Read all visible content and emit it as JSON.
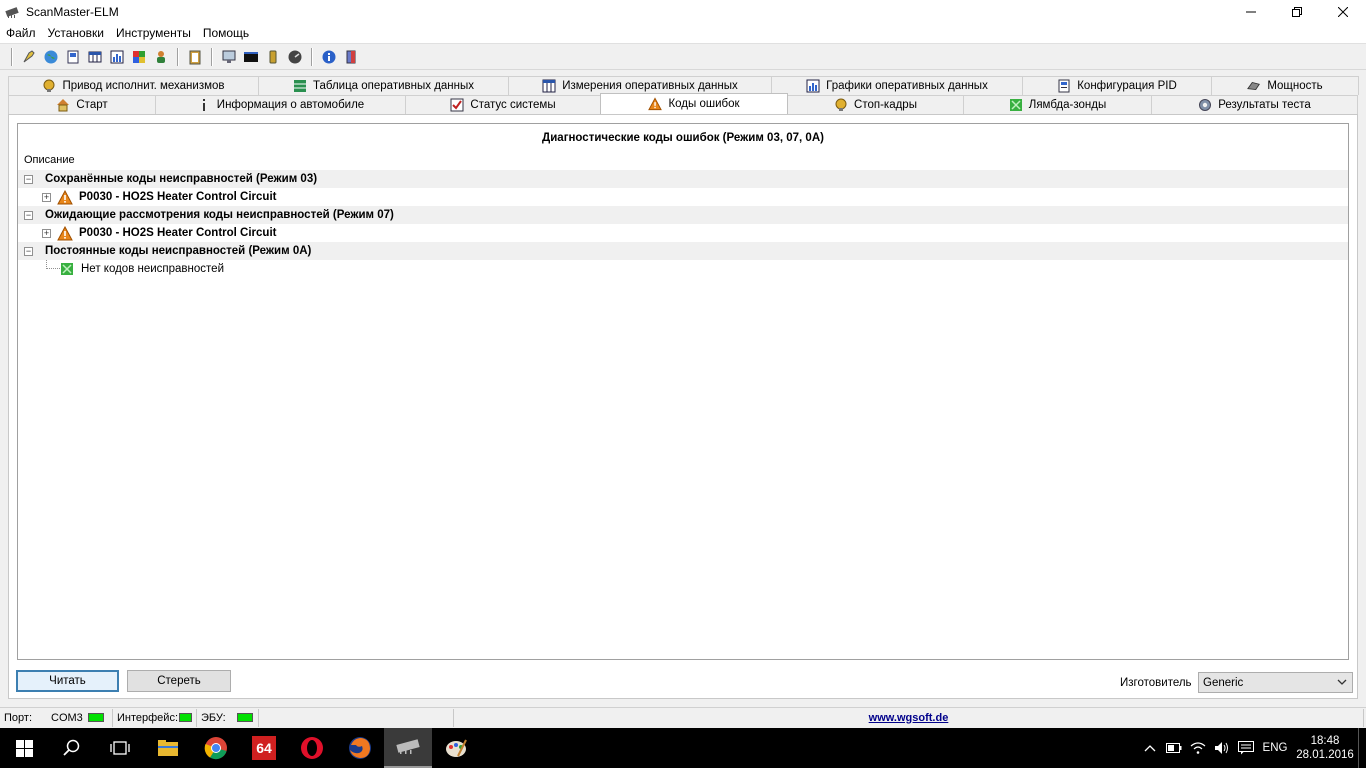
{
  "window": {
    "title": "ScanMaster-ELM"
  },
  "menu": [
    "Файл",
    "Установки",
    "Инструменты",
    "Помощь"
  ],
  "tabs": {
    "row_top": [
      {
        "label": "Привод исполнит. механизмов",
        "icon": "actuator-icon"
      },
      {
        "label": "Таблица оперативных данных",
        "icon": "table-icon"
      },
      {
        "label": "Измерения оперативных данных",
        "icon": "grid-icon"
      },
      {
        "label": "Графики оперативных данных",
        "icon": "chart-icon"
      },
      {
        "label": "Конфигурация PID",
        "icon": "config-icon"
      },
      {
        "label": "Мощность",
        "icon": "power-icon"
      }
    ],
    "row_bottom": [
      {
        "label": "Старт",
        "icon": "home-icon"
      },
      {
        "label": "Информация о автомобиле",
        "icon": "info-icon"
      },
      {
        "label": "Статус системы",
        "icon": "checklist-icon"
      },
      {
        "label": "Коды ошибок",
        "icon": "warning-icon",
        "active": true
      },
      {
        "label": "Стоп-кадры",
        "icon": "freeze-icon"
      },
      {
        "label": "Лямбда-зонды",
        "icon": "sensor-icon"
      },
      {
        "label": "Результаты теста",
        "icon": "gear-icon"
      }
    ]
  },
  "content": {
    "heading": "Диагностические коды ошибок (Режим 03, 07, 0A)",
    "column_header": "Описание",
    "groups": [
      {
        "label": "Сохранённые коды неисправностей (Режим 03)",
        "items": [
          {
            "label": "P0030 - HO2S Heater Control Circuit"
          }
        ]
      },
      {
        "label": "Ожидающие рассмотрения коды неисправностей (Режим 07)",
        "items": [
          {
            "label": "P0030 - HO2S Heater Control Circuit"
          }
        ]
      },
      {
        "label": "Постоянные коды неисправностей  (Режим 0A)",
        "leaf": "Нет кодов неисправностей"
      }
    ]
  },
  "buttons": {
    "read": "Читать",
    "erase": "Стереть"
  },
  "manufacturer": {
    "label": "Изготовитель",
    "value": "Generic"
  },
  "status": {
    "port_label": "Порт:",
    "port_value": "COM3",
    "interface_label": "Интерфейс:",
    "ecu_label": "ЭБУ:",
    "link": "www.wgsoft.de"
  },
  "taskbar": {
    "lang": "ENG",
    "time": "18:48",
    "date": "28.01.2016",
    "badge": "64"
  },
  "colors": {
    "led": "#00e000",
    "warning": "#e8861a",
    "link": "#00008b"
  }
}
